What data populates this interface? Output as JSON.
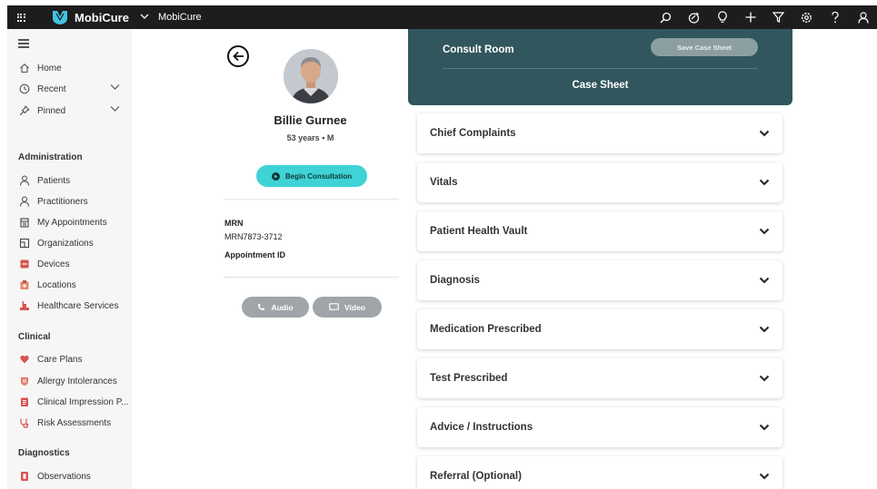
{
  "topbar": {
    "brand": "MobiCure",
    "breadcrumb": "MobiCure",
    "icons": [
      "search-icon",
      "activity-icon",
      "lightbulb-icon",
      "add-icon",
      "filter-icon",
      "settings-icon",
      "help-icon",
      "user-icon"
    ]
  },
  "sidebar": {
    "nav": [
      {
        "label": "Home",
        "icon": "home-icon"
      },
      {
        "label": "Recent",
        "icon": "clock-icon"
      },
      {
        "label": "Pinned",
        "icon": "pin-icon"
      }
    ],
    "sections": [
      {
        "title": "Administration",
        "items": [
          {
            "label": "Patients",
            "icon": "person-icon"
          },
          {
            "label": "Practitioners",
            "icon": "person-icon"
          },
          {
            "label": "My Appointments",
            "icon": "calendar-icon"
          },
          {
            "label": "Organizations",
            "icon": "building-icon"
          },
          {
            "label": "Devices",
            "icon": "device-icon"
          },
          {
            "label": "Locations",
            "icon": "location-icon"
          },
          {
            "label": "Healthcare Services",
            "icon": "service-icon"
          }
        ]
      },
      {
        "title": "Clinical",
        "items": [
          {
            "label": "Care Plans",
            "icon": "heart-icon"
          },
          {
            "label": "Allergy Intolerances",
            "icon": "allergy-icon"
          },
          {
            "label": "Clinical Impression P...",
            "icon": "clipboard-icon"
          },
          {
            "label": "Risk Assessments",
            "icon": "stethoscope-icon"
          }
        ]
      },
      {
        "title": "Diagnostics",
        "items": [
          {
            "label": "Observations",
            "icon": "observation-icon"
          }
        ]
      }
    ]
  },
  "patient": {
    "name": "Billie Gurnee",
    "meta": "53 years • M",
    "begin_label": "Begin Consultation",
    "mrn_label": "MRN",
    "mrn_value": "MRN7873-3712",
    "appointment_label": "Appointment ID",
    "audio_label": "Audio",
    "video_label": "Video"
  },
  "case": {
    "room": "Consult Room",
    "save_label": "Save Case Sheet",
    "title": "Case Sheet",
    "sections": [
      "Chief Complaints",
      "Vitals",
      "Patient Health Vault",
      "Diagnosis",
      "Medication Prescribed",
      "Test Prescribed",
      "Advice / Instructions",
      "Referral (Optional)"
    ]
  },
  "colors": {
    "topbar": "#1d1d1d",
    "sidebar": "#f6f6f6",
    "accent_teal": "#3fd3d6",
    "case_header": "#31565d",
    "call_button": "#9fa5a8",
    "sidebar_icon_red": "#d9534f"
  }
}
